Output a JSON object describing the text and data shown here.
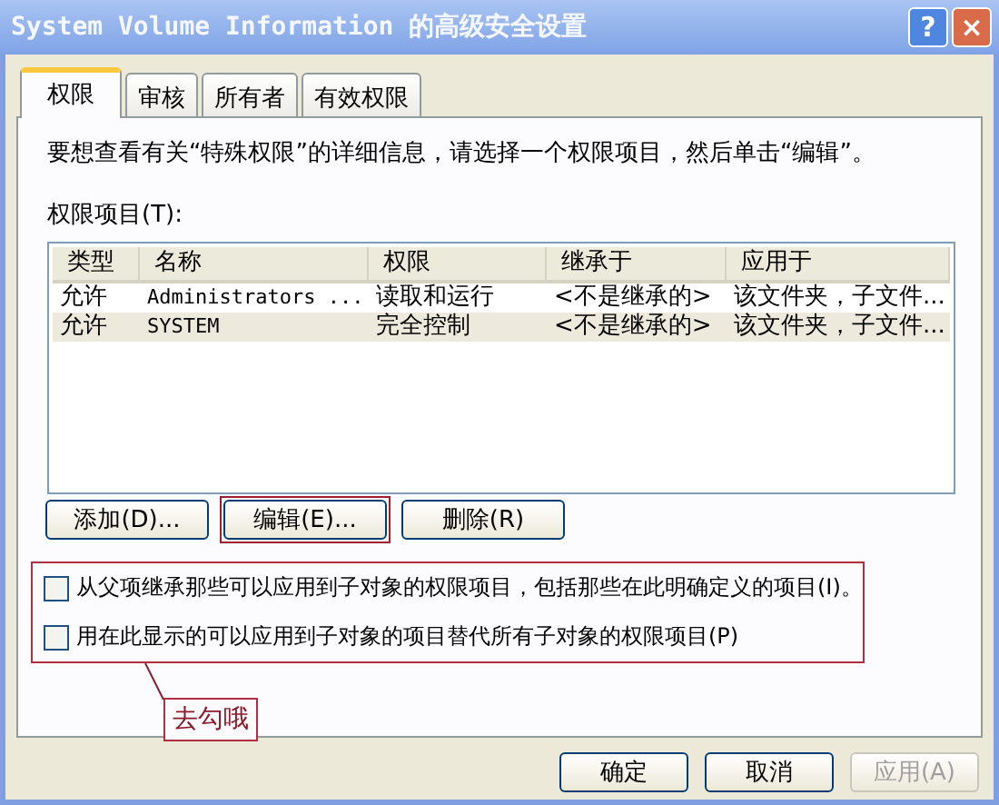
{
  "window": {
    "title": "System Volume Information 的高级安全设置",
    "title_buttons": [
      "?",
      "×"
    ]
  },
  "tabs": [
    {
      "label": "权限",
      "selected": true
    },
    {
      "label": "审核",
      "selected": false
    },
    {
      "label": "所有者",
      "selected": false
    },
    {
      "label": "有效权限",
      "selected": false
    }
  ],
  "instruction": "要想查看有关“特殊权限”的详细信息，请选择一个权限项目，然后单击“编辑”。",
  "list_label": "权限项目(T):",
  "table": {
    "columns": [
      "类型",
      "名称",
      "权限",
      "继承于",
      "应用于"
    ],
    "rows": [
      {
        "cells": [
          "允许",
          "Administrators ...",
          "读取和运行",
          "<不是继承的>",
          "该文件夹，子文件..."
        ],
        "selected": false
      },
      {
        "cells": [
          "允许",
          "SYSTEM",
          "完全控制",
          "<不是继承的>",
          "该文件夹，子文件..."
        ],
        "selected": true
      }
    ]
  },
  "list_buttons": [
    {
      "label": "添加(D)...",
      "highlighted": false
    },
    {
      "label": "编辑(E)...",
      "highlighted": true
    },
    {
      "label": "删除(R)",
      "highlighted": false
    }
  ],
  "options": {
    "highlighted": true,
    "items": [
      {
        "label": "从父项继承那些可以应用到子对象的权限项目，包括那些在此明确定义的项目(I)。",
        "checked": false
      },
      {
        "label": "用在此显示的可以应用到子对象的项目替代所有子对象的权限项目(P)",
        "checked": false
      }
    ]
  },
  "callout": "去勾哦",
  "dialog_buttons": [
    {
      "label": "确定",
      "disabled": false
    },
    {
      "label": "取消",
      "disabled": false
    },
    {
      "label": "应用(A)",
      "disabled": true
    }
  ]
}
